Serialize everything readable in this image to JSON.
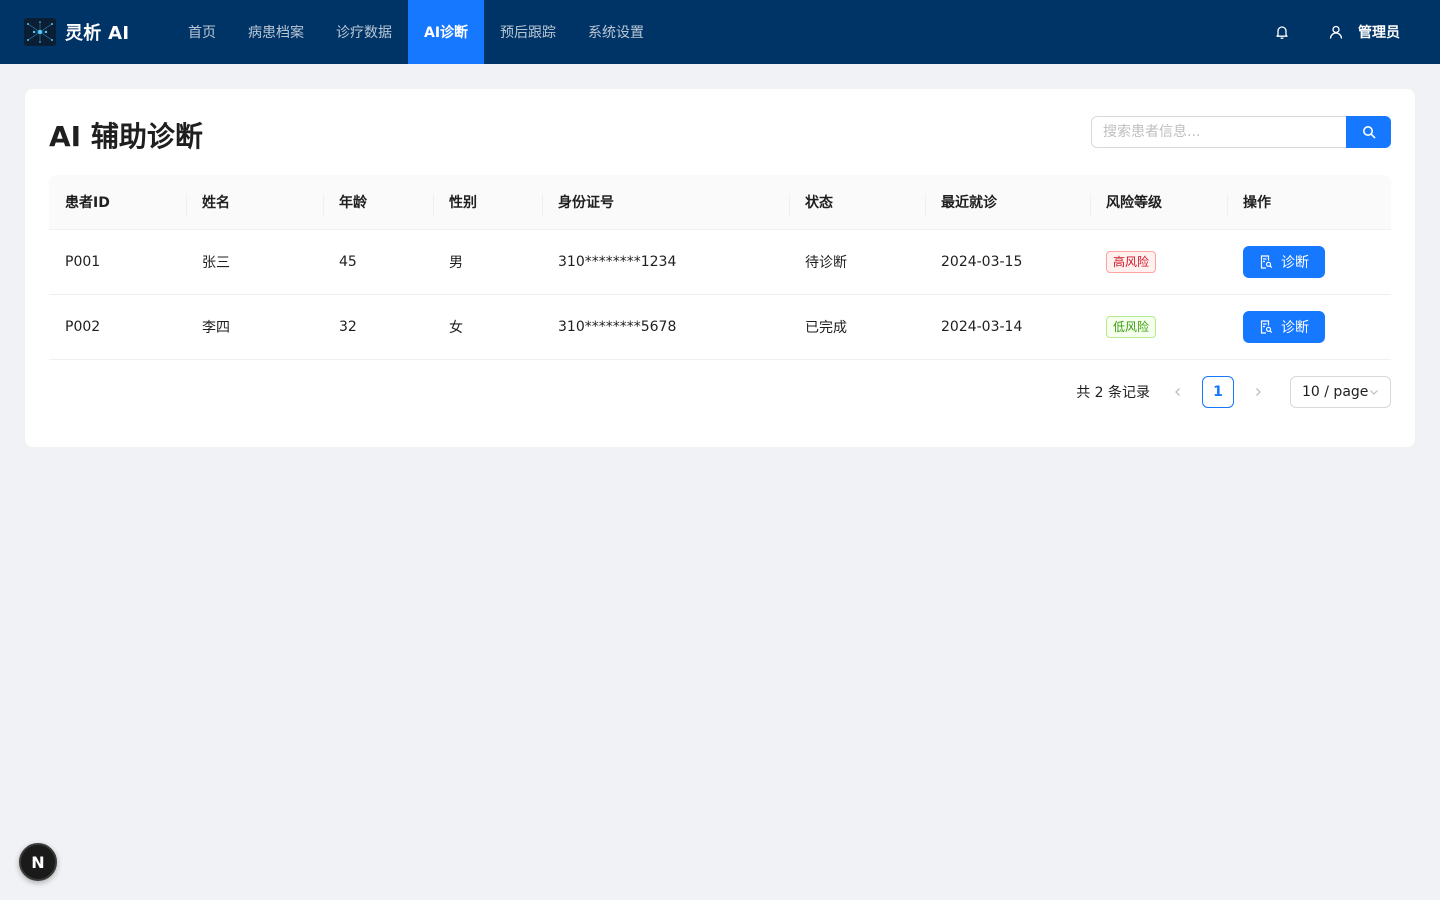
{
  "brand": {
    "name": "灵析 AI",
    "logo_icon": "network-logo-icon"
  },
  "nav": {
    "items": [
      {
        "label": "首页",
        "active": false
      },
      {
        "label": "病患档案",
        "active": false
      },
      {
        "label": "诊疗数据",
        "active": false
      },
      {
        "label": "AI诊断",
        "active": true
      },
      {
        "label": "预后跟踪",
        "active": false
      },
      {
        "label": "系统设置",
        "active": false
      }
    ]
  },
  "header": {
    "user_name": "管理员",
    "bell_icon": "bell-icon",
    "user_icon": "user-icon"
  },
  "page": {
    "title": "AI 辅助诊断",
    "search_placeholder": "搜索患者信息..."
  },
  "table": {
    "columns": [
      "患者ID",
      "姓名",
      "年龄",
      "性别",
      "身份证号",
      "状态",
      "最近就诊",
      "风险等级",
      "操作"
    ],
    "rows": [
      {
        "id": "P001",
        "name": "张三",
        "age": "45",
        "gender": "男",
        "id_card": "310********1234",
        "status": "待诊断",
        "last_visit": "2024-03-15",
        "risk": "高风险",
        "risk_color": "#cf1322",
        "action": "诊断"
      },
      {
        "id": "P002",
        "name": "李四",
        "age": "32",
        "gender": "女",
        "id_card": "310********5678",
        "status": "已完成",
        "last_visit": "2024-03-14",
        "risk": "低风险",
        "risk_color": "#389e0d",
        "action": "诊断"
      }
    ]
  },
  "pagination": {
    "total_text": "共 2 条记录",
    "current_page": "1",
    "page_size": "10 / page"
  },
  "fab": {
    "label": "N"
  },
  "colors": {
    "header_bg": "#003366",
    "primary": "#1677ff",
    "page_bg": "#f0f2f5"
  }
}
